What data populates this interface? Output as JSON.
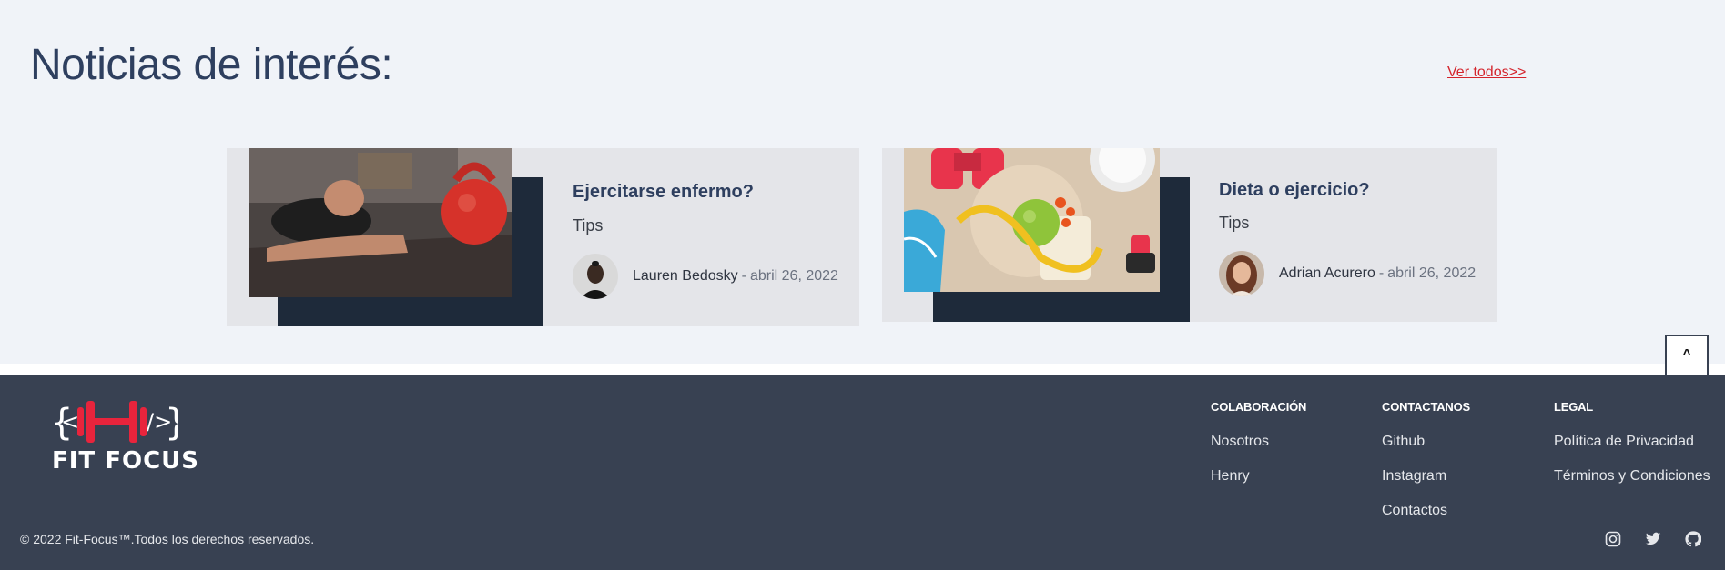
{
  "news": {
    "title": "Noticias de interés:",
    "see_all": "Ver todos>>",
    "cards": [
      {
        "title": "Ejercitarse enfermo?",
        "category": "Tips",
        "author": "Lauren Bedosky",
        "separator": "-",
        "date": "abril 26, 2022"
      },
      {
        "title": "Dieta o ejercicio?",
        "category": "Tips",
        "author": "Adrian Acurero",
        "separator": "-",
        "date": "abril 26, 2022"
      }
    ]
  },
  "scroll_top": {
    "label": "^"
  },
  "footer": {
    "logo_text": "FIT FOCUS",
    "copyright": "© 2022 Fit-Focus™.Todos los derechos reservados.",
    "columns": [
      {
        "heading": "COLABORACIÓN",
        "links": [
          "Nosotros",
          "Henry"
        ]
      },
      {
        "heading": "CONTACTANOS",
        "links": [
          "Github",
          "Instagram",
          "Contactos"
        ]
      },
      {
        "heading": "LEGAL",
        "links": [
          "Política de Privacidad",
          "Términos y Condiciones"
        ]
      }
    ],
    "socials": [
      "instagram-icon",
      "twitter-icon",
      "github-icon"
    ]
  },
  "colors": {
    "heading": "#2e3f5f",
    "link_accent": "#d4242c",
    "footer_bg": "#384152",
    "card_bg": "#e4e5e9",
    "card_shadow": "#1e2a3a",
    "logo_red": "#e8243c"
  }
}
